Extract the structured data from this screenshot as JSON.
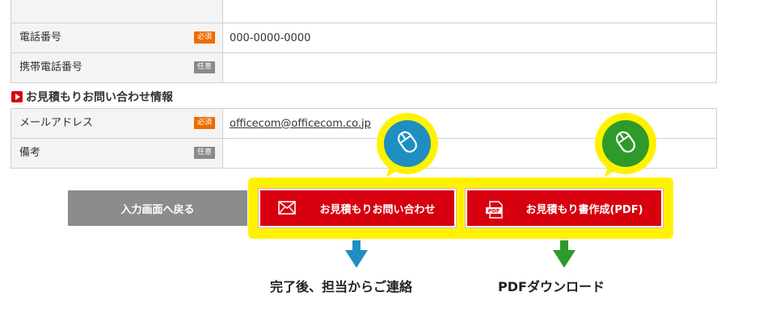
{
  "contact_table": {
    "rows": [
      {
        "label": "",
        "badge": "",
        "value": ""
      },
      {
        "label": "電話番号",
        "badge": "必須",
        "value": "000-0000-0000"
      },
      {
        "label": "携帯電話番号",
        "badge": "任意",
        "value": ""
      }
    ]
  },
  "estimate_section": {
    "title": "お見積もりお問い合わせ情報",
    "rows": [
      {
        "label": "メールアドレス",
        "badge": "必須",
        "value": "officecom@officecom.co.jp"
      },
      {
        "label": "備考",
        "badge": "任意",
        "value": ""
      }
    ]
  },
  "buttons": {
    "back_label": "入力画面へ戻る",
    "inquiry_label": "お見積もりお問い合わせ",
    "pdf_label": "お見積もり書作成(PDF)"
  },
  "captions": {
    "inquiry": "完了後、担当からご連絡",
    "pdf": "PDFダウンロード"
  },
  "icons": {
    "section_marker": "play-icon",
    "inquiry": "envelope-icon",
    "pdf": "pdf-file-icon",
    "callout": "mouse-icon"
  },
  "colors": {
    "accent_red": "#d7000f",
    "required_badge": "#ef6c00",
    "optional_badge": "#8a8a8a",
    "highlight_yellow": "#fff200",
    "blue": "#1e8fc0",
    "green": "#2d9a2a"
  }
}
